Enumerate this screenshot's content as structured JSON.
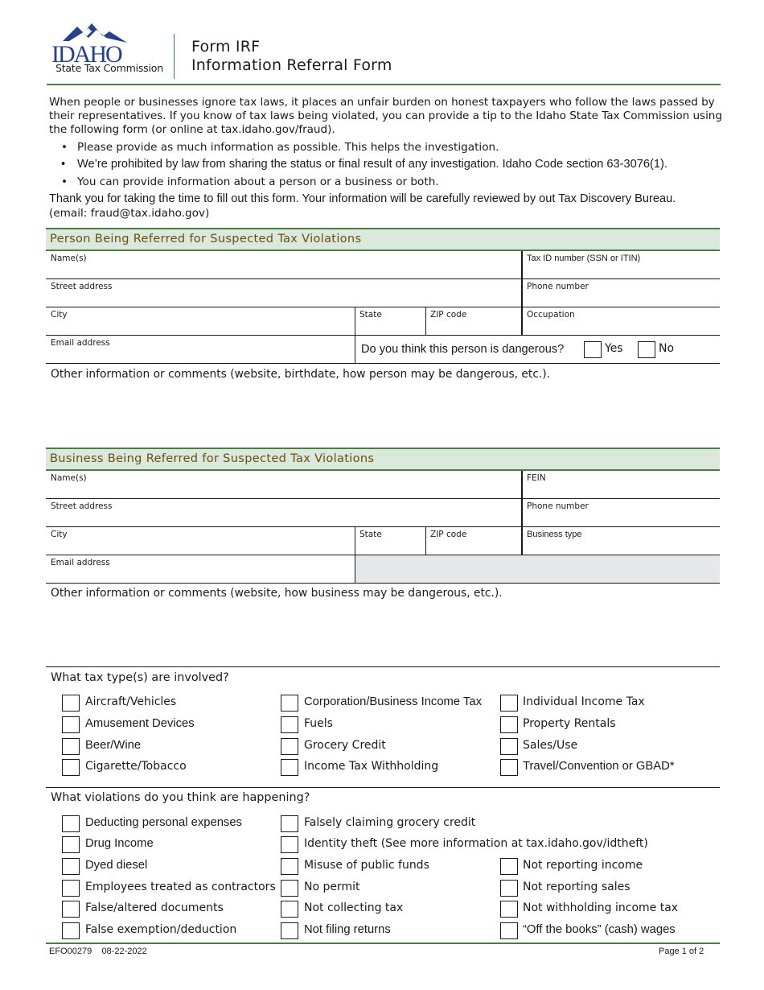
{
  "header": {
    "logo_wordmark": "IDAHO",
    "logo_subtitle": "State Tax Commission",
    "form_number": "Form IRF",
    "form_name": "Information Referral Form",
    "brand_colors": {
      "logo_blue": "#26408b",
      "accent_green": "#4a7c45",
      "section_bg": "#dbe9dc",
      "section_text": "#6b4e16"
    }
  },
  "intro": {
    "paragraph": "When people or businesses ignore tax laws, it places an unfair burden on honest taxpayers who follow the laws passed by their representatives. If you know of tax laws being violated, you can provide a tip to the Idaho State Tax Commission using the following form (or online at tax.idaho.gov/fraud).",
    "bullets": [
      "Please provide as much information as possible. This helps the investigation.",
      "We’re prohibited by law from sharing the status or final result of any investigation. Idaho Code section 63-3076(1).",
      "You can provide information about a person or a business or both."
    ],
    "bullet_glyph": "•",
    "thanks": "Thank you for taking the time to fill out this form. Your information will be carefully reviewed by out Tax Discovery Bureau.",
    "email_line": "(email: fraud@tax.idaho.gov)"
  },
  "person": {
    "title": "Person Being Referred for Suspected Tax Violations",
    "fields": {
      "names": "Name(s)",
      "tax_id": "Tax ID number (SSN or ITIN)",
      "street": "Street address",
      "phone": "Phone number",
      "city": "City",
      "state": "State",
      "zip": "ZIP code",
      "occupation": "Occupation",
      "email": "Email address"
    },
    "dangerous_question": "Do you think this person is dangerous?",
    "yes_label": "Yes",
    "no_label": "No",
    "comments_label": "Other information or comments (website, birthdate, how person may be dangerous, etc.)."
  },
  "business": {
    "title": "Business Being Referred for Suspected Tax Violations",
    "fields": {
      "names": "Name(s)",
      "fein": "FEIN",
      "street": "Street address",
      "phone": "Phone number",
      "city": "City",
      "state": "State",
      "zip": "ZIP code",
      "business_type": "Business type",
      "email": "Email address"
    },
    "comments_label": "Other information or comments (website, how business may be dangerous, etc.)."
  },
  "tax_types": {
    "question": "What tax type(s) are involved?",
    "columns": [
      [
        "Aircraft/Vehicles",
        "Amusement Devices",
        "Beer/Wine",
        "Cigarette/Tobacco"
      ],
      [
        "Corporation/Business Income Tax",
        "Fuels",
        "Grocery Credit",
        "Income Tax Withholding"
      ],
      [
        "Individual Income Tax",
        "Property Rentals",
        "Sales/Use",
        "Travel/Convention or GBAD*"
      ]
    ]
  },
  "violations": {
    "question": "What violations do you think are happening?",
    "columns": [
      [
        "Deducting personal expenses",
        "Drug Income",
        "Dyed diesel",
        "Employees treated as contractors",
        "False/altered documents",
        "False exemption/deduction"
      ],
      [
        "Falsely claiming grocery credit",
        "Identity theft (See more information at tax.idaho.gov/idtheft)",
        "Misuse of public funds",
        "No permit",
        "Not collecting tax",
        "Not filing returns"
      ],
      [
        "Not reporting income",
        "Not reporting sales",
        "Not withholding income tax",
        "“Off the books” (cash) wages"
      ]
    ]
  },
  "footer": {
    "form_code": "EFO00279",
    "date": "08-22-2022",
    "page": "Page 1 of 2"
  }
}
